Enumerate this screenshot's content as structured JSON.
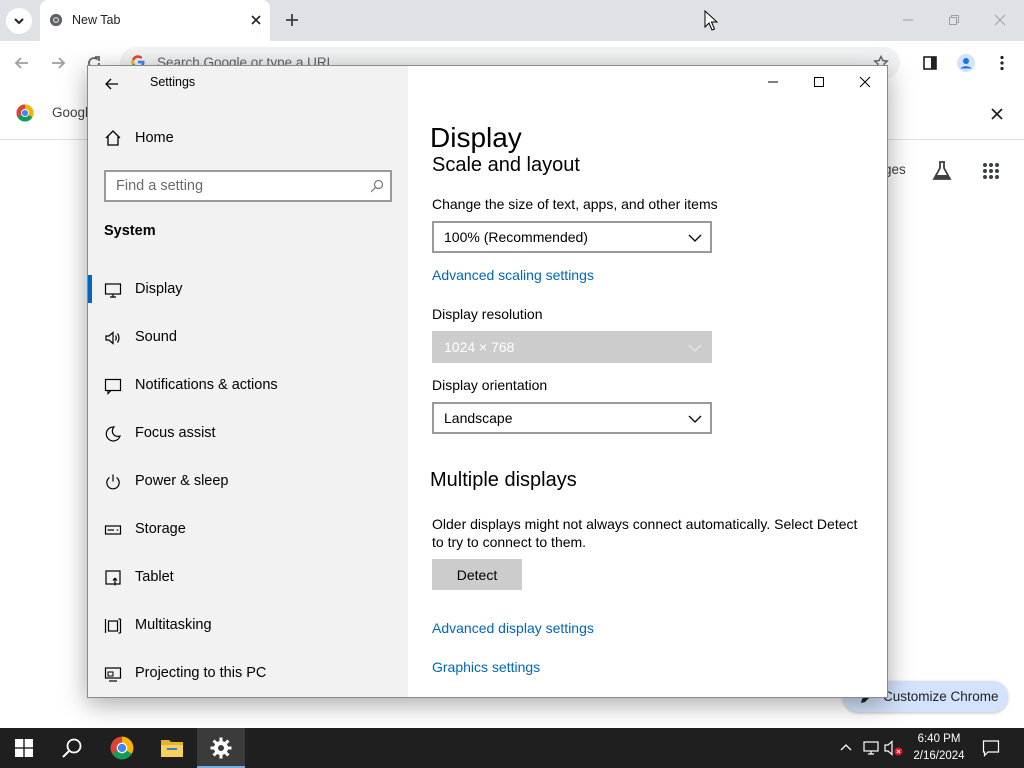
{
  "chrome": {
    "tab_title": "New Tab",
    "omnibox_placeholder": "Search Google or type a URL",
    "bookmark_text": "Googl",
    "ntp_images_partial": "ges",
    "customize_label": "Customize Chrome"
  },
  "settings": {
    "window_title": "Settings",
    "home_label": "Home",
    "search_placeholder": "Find a setting",
    "section_label": "System",
    "nav_items": [
      {
        "label": "Display",
        "icon": "monitor-icon"
      },
      {
        "label": "Sound",
        "icon": "speaker-icon"
      },
      {
        "label": "Notifications & actions",
        "icon": "notification-icon"
      },
      {
        "label": "Focus assist",
        "icon": "moon-icon"
      },
      {
        "label": "Power & sleep",
        "icon": "power-icon"
      },
      {
        "label": "Storage",
        "icon": "storage-icon"
      },
      {
        "label": "Tablet",
        "icon": "tablet-icon"
      },
      {
        "label": "Multitasking",
        "icon": "multitasking-icon"
      },
      {
        "label": "Projecting to this PC",
        "icon": "projecting-icon"
      }
    ],
    "selected_item": "Display",
    "content": {
      "page_title": "Display",
      "scale_section_partial": "Scale and layout",
      "scale_label": "Change the size of text, apps, and other items",
      "scale_value": "100% (Recommended)",
      "advanced_scaling_link": "Advanced scaling settings",
      "resolution_label": "Display resolution",
      "resolution_value": "1024 × 768",
      "orientation_label": "Display orientation",
      "orientation_value": "Landscape",
      "multiple_displays_heading": "Multiple displays",
      "multiple_displays_desc": "Older displays might not always connect automatically. Select Detect to try to connect to them.",
      "detect_button": "Detect",
      "advanced_display_link": "Advanced display settings",
      "graphics_link": "Graphics settings"
    }
  },
  "taskbar": {
    "time": "6:40 PM",
    "date": "2/16/2024",
    "apps": [
      "start-icon",
      "search-icon",
      "chrome-icon",
      "file-explorer-icon",
      "settings-gear-icon"
    ],
    "active_app": "settings-gear-icon"
  },
  "colors": {
    "accent": "#0067c0",
    "link": "#0067b8",
    "taskbar": "#1f1f1f",
    "nav_background": "#f2f2f2",
    "chrome_tabstrip": "#dee1e6"
  }
}
